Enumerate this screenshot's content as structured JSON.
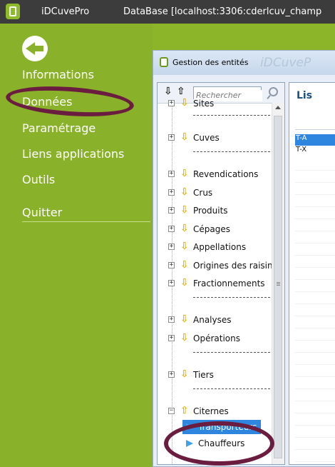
{
  "titlebar": {
    "app_name": "iDCuvePro",
    "db_title": "DataBase [localhost:3306:cderlcuv_champ"
  },
  "sidebar": {
    "items": [
      {
        "label": "Informations"
      },
      {
        "label": "Données"
      },
      {
        "label": "Paramétrage"
      },
      {
        "label": "Liens applications"
      },
      {
        "label": "Outils"
      },
      {
        "label": "Quitter"
      }
    ]
  },
  "dialog": {
    "title": "Gestion des entités",
    "watermark": "iDCuveP"
  },
  "search": {
    "placeholder": "Rechercher"
  },
  "tree": {
    "items": [
      {
        "label": "Sites"
      },
      {
        "label": "Cuves"
      },
      {
        "label": "Revendications"
      },
      {
        "label": "Crus"
      },
      {
        "label": "Produits"
      },
      {
        "label": "Cépages"
      },
      {
        "label": "Appellations"
      },
      {
        "label": "Origines des raisins"
      },
      {
        "label": "Fractionnements"
      },
      {
        "label": "Analyses"
      },
      {
        "label": "Opérations"
      },
      {
        "label": "Tiers"
      },
      {
        "label": "Citernes"
      },
      {
        "label": "Transporteurs"
      },
      {
        "label": "Chauffeurs"
      }
    ]
  },
  "list": {
    "title": "Lis",
    "rows": [
      "T-A",
      "T-X"
    ]
  },
  "colors": {
    "sidebar_green": "#8ab12a",
    "highlight_ellipse": "#6b1d3f",
    "selection_blue": "#2f86de"
  }
}
